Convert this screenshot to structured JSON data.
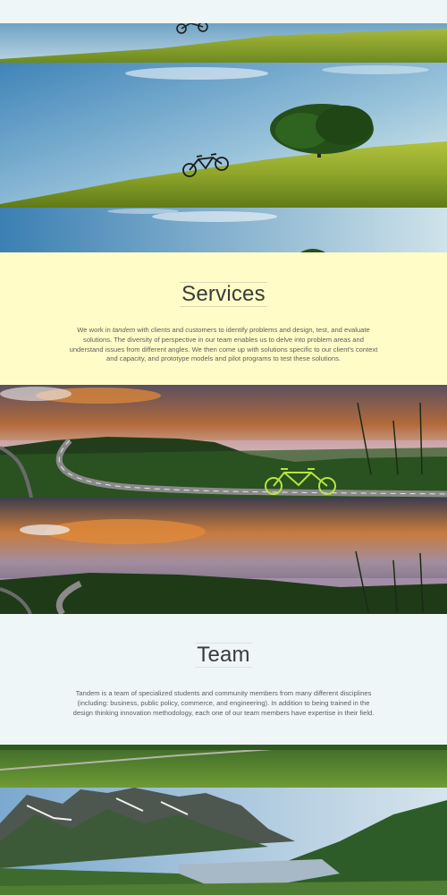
{
  "top_partial_text": "",
  "services": {
    "heading": "Services",
    "body_prefix": "We work in ",
    "body_emphasis": "tandem",
    "body_suffix": " with clients and customers to identify problems and design, test, and evaluate solutions. The diversity of perspective in our team enables us to delve into problem areas and understand issues from different angles. We then come up with solutions specific to our client's context and capacity, and prototype models and pilot programs to test these solutions."
  },
  "team": {
    "heading": "Team",
    "body": "Tandem is a team of specialized students and community members from many different disciplines (including: business, public policy, commerce, and engineering). In addition to being trained in the design thinking innovation methodology, each one of our team members have expertise in their field."
  },
  "colors": {
    "services_bg": "#fffcc7",
    "team_bg": "#eff6f7",
    "accent_bike": "#b6e53d"
  },
  "images": {
    "hill_banner": "hillside-tree-bicycle-photo",
    "sunset_banner": "sunset-road-lake-photo",
    "mountain_banner": "mountain-fjord-valley-photo"
  }
}
